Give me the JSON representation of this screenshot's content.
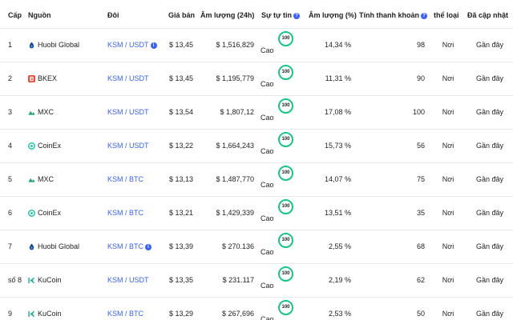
{
  "headers": {
    "rank": "Cấp",
    "source": "Nguồn",
    "pair": "Đôi",
    "price": "Giá bán",
    "volume": "Âm lượng (24h)",
    "confidence": "Sự tự tin",
    "volume_pct": "Âm lượng (%)",
    "liquidity": "Tính thanh khoản",
    "category": "thể loại",
    "updated": "Đã cập nhật"
  },
  "rows": [
    {
      "rank": "1",
      "source": "Huobi Global",
      "icon": "huobi-icon",
      "pair": "KSM / USDT",
      "pair_info": "i",
      "price": "$ 13,45",
      "volume": "$ 1,516,829",
      "conf_label": "Cao",
      "conf_score": "100",
      "volume_pct": "14,34 %",
      "liquidity": "98",
      "category": "Nơi",
      "updated": "Gần đây"
    },
    {
      "rank": "2",
      "source": "BKEX",
      "icon": "bkex-icon",
      "pair": "KSM / USDT",
      "pair_info": "",
      "price": "$ 13,45",
      "volume": "$ 1,195,779",
      "conf_label": "Cao",
      "conf_score": "100",
      "volume_pct": "11,31 %",
      "liquidity": "90",
      "category": "Nơi",
      "updated": "Gần đây"
    },
    {
      "rank": "3",
      "source": "MXC",
      "icon": "mxc-icon",
      "pair": "KSM / USDT",
      "pair_info": "",
      "price": "$ 13,54",
      "volume": "$ 1,807,12",
      "conf_label": "Cao",
      "conf_score": "100",
      "volume_pct": "17,08 %",
      "liquidity": "100",
      "category": "Nơi",
      "updated": "Gần đây"
    },
    {
      "rank": "4",
      "source": "CoinEx",
      "icon": "coinex-icon",
      "pair": "KSM / USDT",
      "pair_info": "",
      "price": "$ 13,22",
      "volume": "$ 1,664,243",
      "conf_label": "Cao",
      "conf_score": "100",
      "volume_pct": "15,73 %",
      "liquidity": "56",
      "category": "Nơi",
      "updated": "Gần đây"
    },
    {
      "rank": "5",
      "source": "MXC",
      "icon": "mxc-icon",
      "pair": "KSM / BTC",
      "pair_info": "",
      "price": "$ 13,13",
      "volume": "$ 1,487,770",
      "conf_label": "Cao",
      "conf_score": "100",
      "volume_pct": "14,07 %",
      "liquidity": "75",
      "category": "Nơi",
      "updated": "Gần đây"
    },
    {
      "rank": "6",
      "source": "CoinEx",
      "icon": "coinex-icon",
      "pair": "KSM / BTC",
      "pair_info": "",
      "price": "$ 13,21",
      "volume": "$ 1,429,339",
      "conf_label": "Cao",
      "conf_score": "100",
      "volume_pct": "13,51 %",
      "liquidity": "35",
      "category": "Nơi",
      "updated": "Gần đây"
    },
    {
      "rank": "7",
      "source": "Huobi Global",
      "icon": "huobi-icon",
      "pair": "KSM / BTC",
      "pair_info": "i",
      "price": "$ 13,39",
      "volume": "$ 270.136",
      "conf_label": "Cao",
      "conf_score": "100",
      "volume_pct": "2,55 %",
      "liquidity": "68",
      "category": "Nơi",
      "updated": "Gần đây"
    },
    {
      "rank": "số 8",
      "source": "KuCoin",
      "icon": "kucoin-icon",
      "pair": "KSM / USDT",
      "pair_info": "",
      "price": "$ 13,35",
      "volume": "$ 231.117",
      "conf_label": "Cao",
      "conf_score": "100",
      "volume_pct": "2,19 %",
      "liquidity": "62",
      "category": "Nơi",
      "updated": "Gần đây"
    },
    {
      "rank": "9",
      "source": "KuCoin",
      "icon": "kucoin-icon",
      "pair": "KSM / BTC",
      "pair_info": "",
      "price": "$ 13,29",
      "volume": "$ 267,696",
      "conf_label": "Cao",
      "conf_score": "100",
      "volume_pct": "2,53 %",
      "liquidity": "50",
      "category": "Nơi",
      "updated": "Gần đây"
    }
  ],
  "colors": {
    "link": "#3861fb",
    "confidence_ring": "#16c784",
    "divider": "#e6e8ea"
  }
}
